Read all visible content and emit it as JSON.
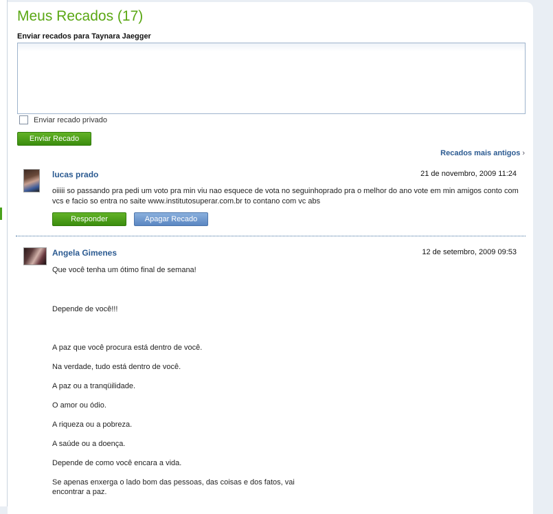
{
  "page": {
    "title": "Meus Recados (17)",
    "send_label": "Enviar recados para Taynara Jaegger",
    "private_label": "Enviar recado privado",
    "send_button": "Enviar Recado",
    "older_link": "Recados mais antigos",
    "older_chevron": "›"
  },
  "messages": [
    {
      "author": "lucas prado",
      "date": "21 de novembro, 2009 11:24",
      "text": "oiiiii so passando pra pedi um voto pra min viu nao esquece de vota no seguinhoprado pra o melhor do ano vote em min amigos conto com vcs e facio so entra no saite www.institutosuperar.com.br to contano com vc abs",
      "reply_button": "Responder",
      "delete_button": "Apagar Recado"
    },
    {
      "author": "Angela Gimenes",
      "date": "12 de setembro, 2009 09:53",
      "paragraphs": [
        "Que você tenha um ótimo final de semana!",
        "Depende de você!!!",
        "A paz que você procura está dentro de você.",
        "Na verdade, tudo está dentro de você.",
        "A paz ou a tranqüilidade.",
        "O amor ou ódio.",
        "A riqueza ou a pobreza.",
        "A saúde ou a doença.",
        "Depende de como você encara a vida.",
        "Se apenas enxerga o lado bom das pessoas, das coisas e dos fatos, vai encontrar a paz."
      ]
    }
  ],
  "colors": {
    "title_green": "#5aa713",
    "link_blue": "#2b5a91",
    "button_green": "#4aa11c",
    "button_blue": "#6a94cc"
  }
}
